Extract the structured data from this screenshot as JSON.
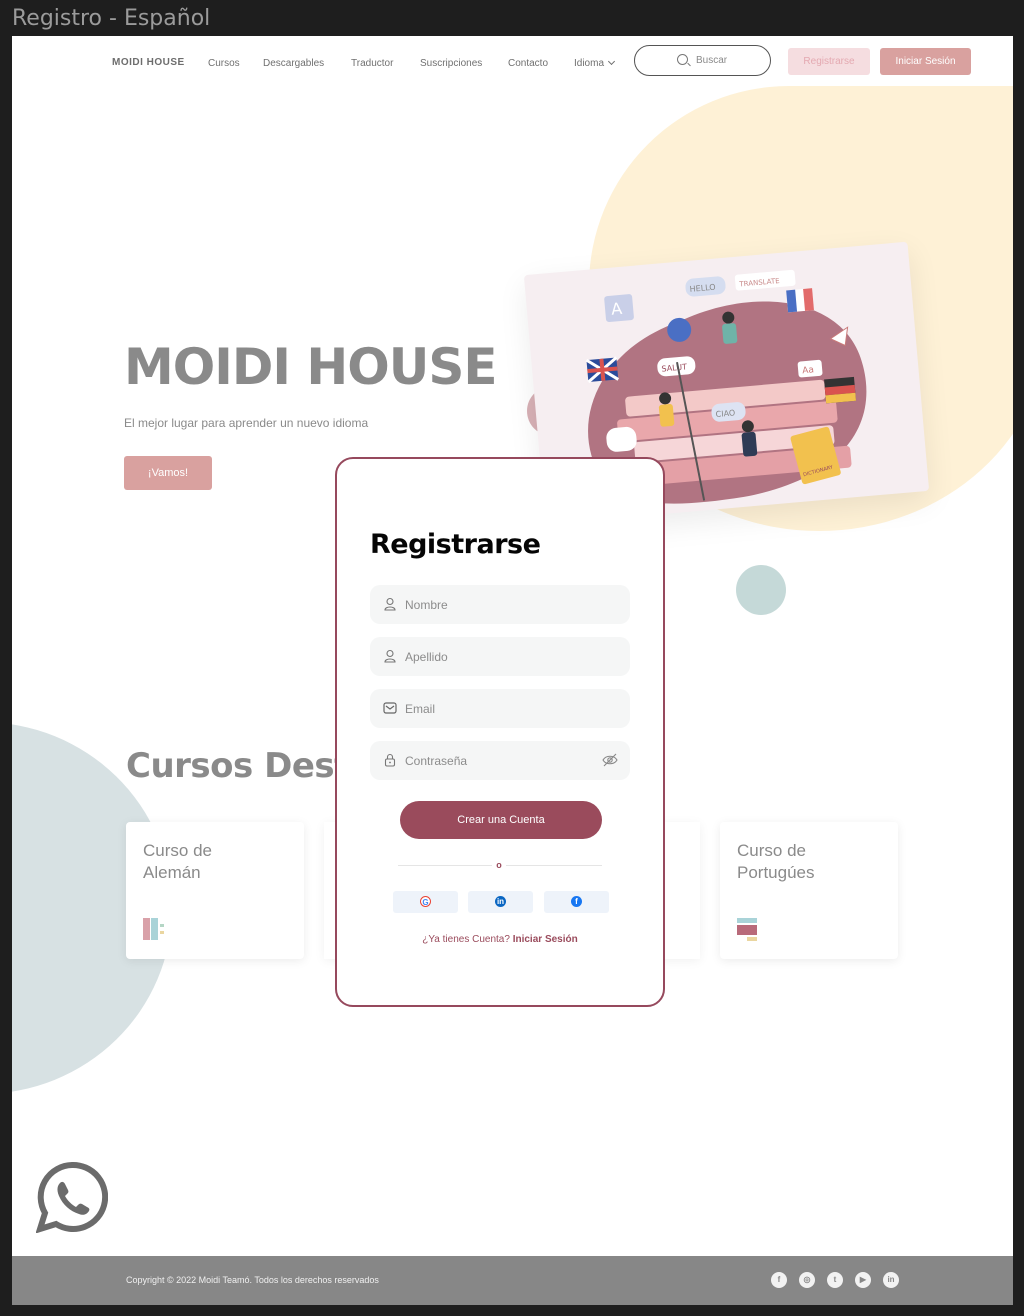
{
  "frame": {
    "title": "Registro - Español"
  },
  "nav": {
    "brand": "MOIDI HOUSE",
    "links": [
      "Cursos",
      "Descargables",
      "Traductor",
      "Suscripciones",
      "Contacto",
      "Idioma"
    ],
    "search_placeholder": "Buscar",
    "register_label": "Registrarse",
    "login_label": "Iniciar Sesión"
  },
  "hero": {
    "title": "MOIDI HOUSE",
    "subtitle": "El mejor lugar para aprender un nuevo idioma",
    "cta": "¡Vamos!"
  },
  "illustration_words": [
    "HELLO",
    "TRANSLATE",
    "SALUT",
    "CIAO",
    "Aa",
    "DICTIONARY",
    "A"
  ],
  "courses": {
    "section_title": "Cursos Destacados",
    "cards": [
      {
        "title": "Curso de\nAlemán"
      },
      {
        "title": "Curso de\nPortugúes"
      }
    ]
  },
  "modal": {
    "title": "Registrarse",
    "fields": {
      "first_name": "Nombre",
      "last_name": "Apellido",
      "email": "Email",
      "password": "Contraseña"
    },
    "submit_label": "Crear una Cuenta",
    "divider_label": "o",
    "social": [
      "google-icon",
      "linkedin-icon",
      "facebook-icon"
    ],
    "have_account": "¿Ya tienes Cuenta?",
    "login_link": "Iniciar Sesión"
  },
  "footer": {
    "copyright": "Copyright © 2022 Moidi Teamó. Todos los derechos reservados",
    "social": [
      "facebook-icon",
      "instagram-icon",
      "twitter-icon",
      "youtube-icon",
      "linkedin-icon"
    ]
  },
  "colors": {
    "accent": "#9a4b5c",
    "rose": "#d9a19f",
    "grey_text": "#8a8a8a",
    "footer": "#878787"
  }
}
